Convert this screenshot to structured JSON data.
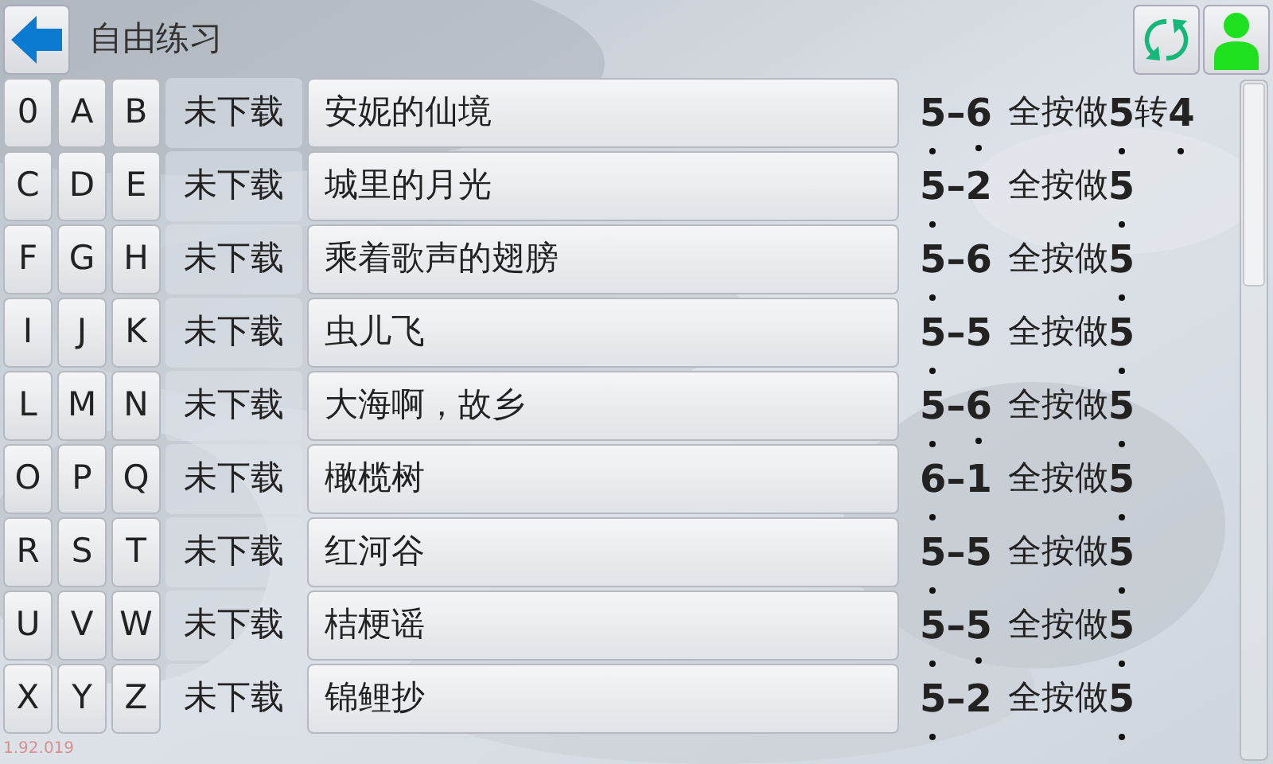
{
  "header": {
    "title": "自由练习"
  },
  "rows": [
    {
      "letters": [
        "0",
        "A",
        "B"
      ],
      "status": "未下载",
      "title": "安妮的仙境",
      "tune": [
        {
          "text": "5",
          "dot_below": true,
          "dot_above": false
        },
        {
          "text": "–",
          "dot_below": false,
          "dot_above": false
        },
        {
          "text": "6",
          "dot_below": false,
          "dot_above": false
        }
      ],
      "key_label": "全按做",
      "key": [
        {
          "text": "5",
          "dot_below": true,
          "dot_above": false
        },
        {
          "text": "转",
          "dot_below": false,
          "dot_above": false
        },
        {
          "text": "4",
          "dot_below": true,
          "dot_above": false
        }
      ]
    },
    {
      "letters": [
        "C",
        "D",
        "E"
      ],
      "status": "未下载",
      "title": "城里的月光",
      "tune": [
        {
          "text": "5",
          "dot_below": true,
          "dot_above": false
        },
        {
          "text": "–",
          "dot_below": false,
          "dot_above": false
        },
        {
          "text": "2",
          "dot_below": false,
          "dot_above": true
        }
      ],
      "key_label": "全按做",
      "key": [
        {
          "text": "5",
          "dot_below": true,
          "dot_above": false
        }
      ]
    },
    {
      "letters": [
        "F",
        "G",
        "H"
      ],
      "status": "未下载",
      "title": "乘着歌声的翅膀",
      "tune": [
        {
          "text": "5",
          "dot_below": true,
          "dot_above": false
        },
        {
          "text": "–",
          "dot_below": false,
          "dot_above": false
        },
        {
          "text": "6",
          "dot_below": false,
          "dot_above": false
        }
      ],
      "key_label": "全按做",
      "key": [
        {
          "text": "5",
          "dot_below": true,
          "dot_above": false
        }
      ]
    },
    {
      "letters": [
        "I",
        "J",
        "K"
      ],
      "status": "未下载",
      "title": "虫儿飞",
      "tune": [
        {
          "text": "5",
          "dot_below": true,
          "dot_above": false
        },
        {
          "text": "–",
          "dot_below": false,
          "dot_above": false
        },
        {
          "text": "5",
          "dot_below": false,
          "dot_above": false
        }
      ],
      "key_label": "全按做",
      "key": [
        {
          "text": "5",
          "dot_below": true,
          "dot_above": false
        }
      ]
    },
    {
      "letters": [
        "L",
        "M",
        "N"
      ],
      "status": "未下载",
      "title": "大海啊，故乡",
      "tune": [
        {
          "text": "5",
          "dot_below": true,
          "dot_above": false
        },
        {
          "text": "–",
          "dot_below": false,
          "dot_above": false
        },
        {
          "text": "6",
          "dot_below": false,
          "dot_above": false
        }
      ],
      "key_label": "全按做",
      "key": [
        {
          "text": "5",
          "dot_below": true,
          "dot_above": false
        }
      ]
    },
    {
      "letters": [
        "O",
        "P",
        "Q"
      ],
      "status": "未下载",
      "title": "橄榄树",
      "tune": [
        {
          "text": "6",
          "dot_below": true,
          "dot_above": false
        },
        {
          "text": "–",
          "dot_below": false,
          "dot_above": false
        },
        {
          "text": "1",
          "dot_below": false,
          "dot_above": true
        }
      ],
      "key_label": "全按做",
      "key": [
        {
          "text": "5",
          "dot_below": true,
          "dot_above": false
        }
      ]
    },
    {
      "letters": [
        "R",
        "S",
        "T"
      ],
      "status": "未下载",
      "title": "红河谷",
      "tune": [
        {
          "text": "5",
          "dot_below": true,
          "dot_above": false
        },
        {
          "text": "–",
          "dot_below": false,
          "dot_above": false
        },
        {
          "text": "5",
          "dot_below": false,
          "dot_above": false
        }
      ],
      "key_label": "全按做",
      "key": [
        {
          "text": "5",
          "dot_below": true,
          "dot_above": false
        }
      ]
    },
    {
      "letters": [
        "U",
        "V",
        "W"
      ],
      "status": "未下载",
      "title": "桔梗谣",
      "tune": [
        {
          "text": "5",
          "dot_below": true,
          "dot_above": false
        },
        {
          "text": "–",
          "dot_below": false,
          "dot_above": false
        },
        {
          "text": "5",
          "dot_below": false,
          "dot_above": false
        }
      ],
      "key_label": "全按做",
      "key": [
        {
          "text": "5",
          "dot_below": true,
          "dot_above": false
        }
      ]
    },
    {
      "letters": [
        "X",
        "Y",
        "Z"
      ],
      "status": "未下载",
      "title": "锦鲤抄",
      "tune": [
        {
          "text": "5",
          "dot_below": true,
          "dot_above": false
        },
        {
          "text": "–",
          "dot_below": false,
          "dot_above": false
        },
        {
          "text": "2",
          "dot_below": false,
          "dot_above": true
        }
      ],
      "key_label": "全按做",
      "key": [
        {
          "text": "5",
          "dot_below": true,
          "dot_above": false
        }
      ]
    }
  ],
  "version": "1.92.019"
}
